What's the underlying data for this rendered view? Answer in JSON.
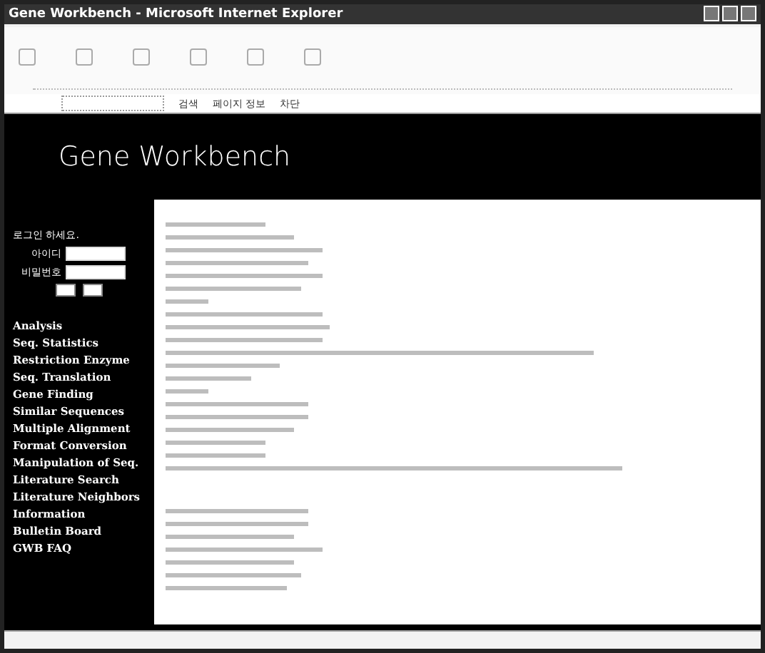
{
  "window": {
    "title": "Gene Workbench - Microsoft Internet Explorer"
  },
  "links_bar": {
    "items": [
      "검색",
      "페이지 정보",
      "차단"
    ]
  },
  "banner": {
    "title": "Gene Workbench"
  },
  "login": {
    "heading": "로그인 하세요.",
    "fields": [
      {
        "label": "아이디"
      },
      {
        "label": "비밀번호"
      }
    ]
  },
  "nav": {
    "items": [
      "Analysis",
      "Seq. Statistics",
      "Restriction Enzyme",
      "Seq. Translation",
      "Gene Finding",
      "Similar Sequences",
      "Multiple Alignment",
      "Format Conversion",
      "Manipulation of Seq.",
      "Literature Search",
      "Literature Neighbors",
      "Information",
      "Bulletin Board",
      "GWB FAQ"
    ]
  }
}
